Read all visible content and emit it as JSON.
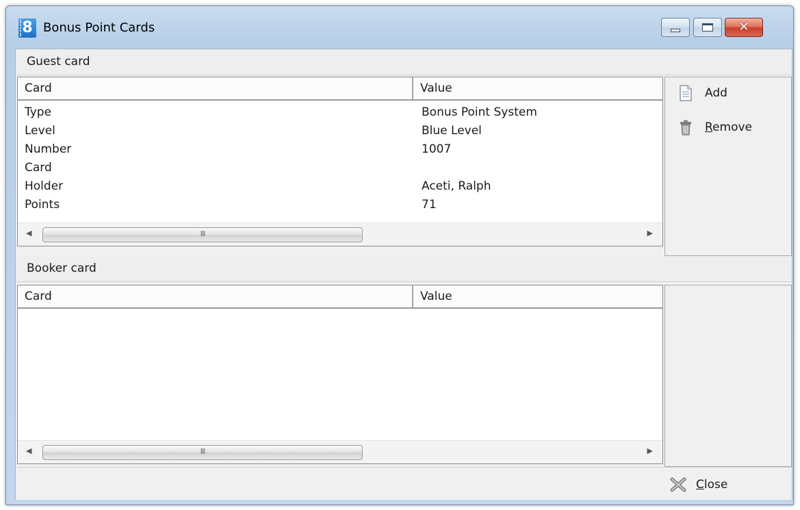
{
  "window": {
    "title": "Bonus Point Cards",
    "app_icon_glyph": "8",
    "controls": {
      "minimize": "minimize-icon",
      "maximize": "maximize-icon",
      "close_glyph": "✕"
    }
  },
  "guest_section": {
    "header": "Guest card",
    "columns": [
      "Card",
      "Value"
    ],
    "rows": [
      {
        "card": "Type",
        "value": "Bonus Point System"
      },
      {
        "card": "Level",
        "value": "Blue Level"
      },
      {
        "card": "Number",
        "value": "1007"
      },
      {
        "card": "Card",
        "value": ""
      },
      {
        "card": "Holder",
        "value": "Aceti, Ralph"
      },
      {
        "card": "Points",
        "value": "71"
      }
    ],
    "scroll_thumb_grip": "III",
    "actions": {
      "add": "Add",
      "remove": "Remove"
    }
  },
  "booker_section": {
    "header": "Booker card",
    "columns": [
      "Card",
      "Value"
    ],
    "rows": [],
    "scroll_thumb_grip": "III"
  },
  "footer": {
    "close": "Close"
  },
  "icons": {
    "add": "document-icon",
    "remove": "trash-icon",
    "close": "close-x-icon"
  }
}
